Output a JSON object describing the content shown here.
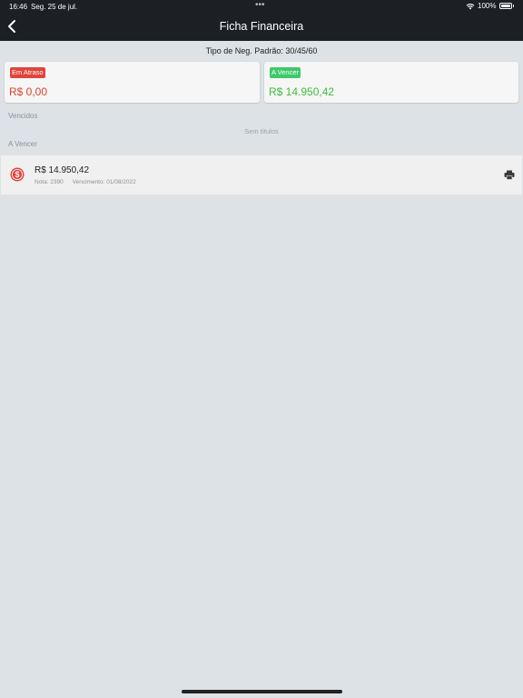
{
  "status_bar": {
    "time": "16:46",
    "date": "Seg. 25 de jul.",
    "battery": "100%"
  },
  "nav": {
    "title": "Ficha Financeira"
  },
  "subheader": "Tipo de Neg. Padrão: 30/45/60",
  "cards": [
    {
      "badge": "Em Atraso",
      "amount": "R$ 0,00",
      "color": "#e0453b"
    },
    {
      "badge": "A Vencer",
      "amount": "R$ 14.950,42",
      "color": "#3ec96a"
    }
  ],
  "sections": {
    "vencidos_label": "Vencidos",
    "vencidos_empty": "Sem títulos",
    "avencer_label": "A Vencer"
  },
  "items": [
    {
      "amount": "R$ 14.950,42",
      "nota": "Nota: 2390",
      "vencimento": "Vencimento: 01/08/2022",
      "icon": "dollar-circle-icon"
    }
  ]
}
